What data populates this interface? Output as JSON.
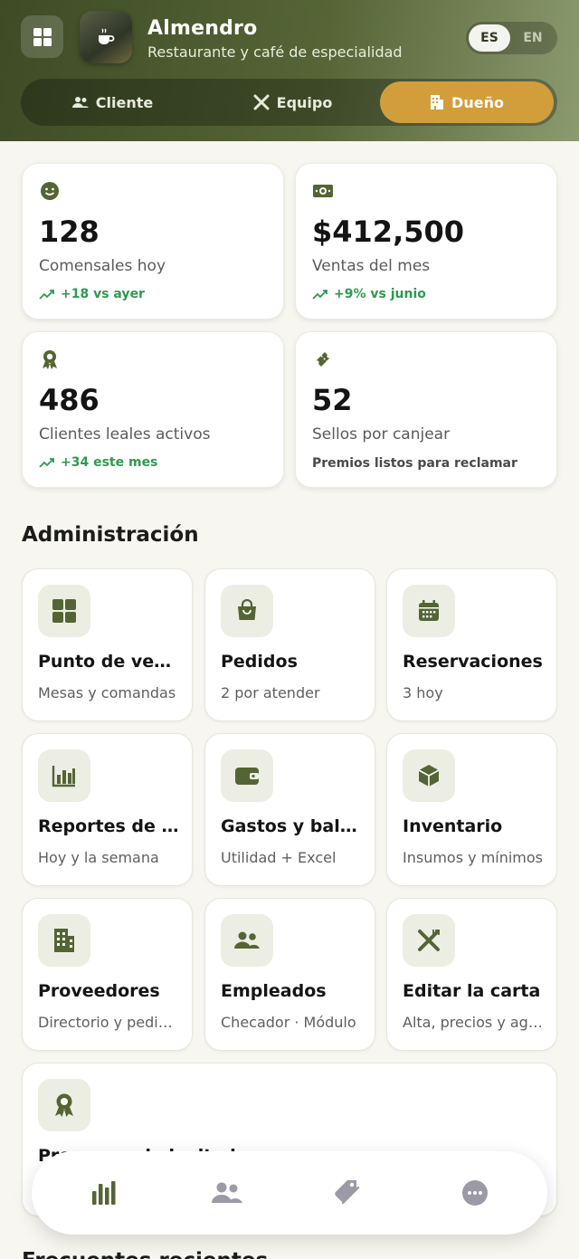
{
  "header": {
    "app_name": "Almendro",
    "subtitle": "Restaurante y café de especialidad",
    "languages": [
      "ES",
      "EN"
    ],
    "active_language": "ES",
    "roles": [
      {
        "label": "Cliente",
        "icon": "users-icon"
      },
      {
        "label": "Equipo",
        "icon": "utensils-icon"
      },
      {
        "label": "Dueño",
        "icon": "building-icon",
        "active": true
      }
    ]
  },
  "stats": [
    {
      "icon": "smile-icon",
      "value": "128",
      "label": "Comensales hoy",
      "trend": "+18 vs ayer"
    },
    {
      "icon": "money-icon",
      "value": "$412,500",
      "label": "Ventas del mes",
      "trend": "+9% vs junio"
    },
    {
      "icon": "award-icon",
      "value": "486",
      "label": "Clientes leales activos",
      "trend": "+34 este mes"
    },
    {
      "icon": "ticket-icon",
      "value": "52",
      "label": "Sellos por canjear",
      "note": "Premios listos para reclamar"
    }
  ],
  "admin": {
    "title": "Administración",
    "tiles": [
      {
        "icon": "grid-icon",
        "title": "Punto de venta",
        "subtitle": "Mesas y comandas"
      },
      {
        "icon": "bag-icon",
        "title": "Pedidos",
        "subtitle": "2 por atender"
      },
      {
        "icon": "calendar-icon",
        "title": "Reservaciones",
        "subtitle": "3 hoy"
      },
      {
        "icon": "chart-icon",
        "title": "Reportes de ventas",
        "subtitle": "Hoy y la semana"
      },
      {
        "icon": "wallet-icon",
        "title": "Gastos y balance",
        "subtitle": "Utilidad + Excel"
      },
      {
        "icon": "box-icon",
        "title": "Inventario",
        "subtitle": "Insumos y mínimos"
      },
      {
        "icon": "building-icon",
        "title": "Proveedores",
        "subtitle": "Directorio y pedidos"
      },
      {
        "icon": "users-icon",
        "title": "Empleados",
        "subtitle": "Checador · Módulo"
      },
      {
        "icon": "utensils-icon",
        "title": "Editar la carta",
        "subtitle": "Alta, precios y agotados"
      },
      {
        "icon": "award-icon",
        "title": "Programa de lealtad",
        "subtitle": ""
      }
    ]
  },
  "bottom_nav": [
    {
      "icon": "bar-chart-icon",
      "active": true
    },
    {
      "icon": "users-icon"
    },
    {
      "icon": "tag-icon"
    },
    {
      "icon": "more-icon"
    }
  ],
  "next_section_title": "Frecuentes recientes",
  "colors": {
    "brand": "#556434",
    "accent": "#d29e3b",
    "trend": "#2e9a4f",
    "background": "#f7f6f0"
  }
}
